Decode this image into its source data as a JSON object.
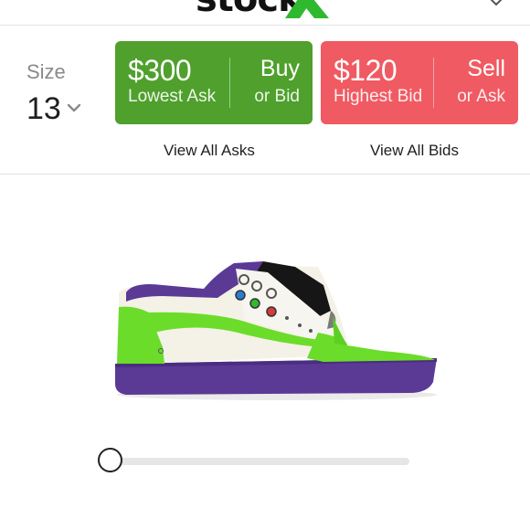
{
  "header": {
    "logo_text": "stock",
    "logo_accent_color": "#2fb92f"
  },
  "size": {
    "label": "Size",
    "value": "13"
  },
  "ask": {
    "price": "$300",
    "price_caption": "Lowest Ask",
    "action_label": "Buy",
    "action_sub": "or Bid",
    "color": "#4fa02c"
  },
  "bid": {
    "price": "$120",
    "price_caption": "Highest Bid",
    "action_label": "Sell",
    "action_sub": "or Ask",
    "color": "#f05a62"
  },
  "links": {
    "view_asks": "View All Asks",
    "view_bids": "View All Bids"
  },
  "viewer": {
    "rotation_position": 0
  }
}
